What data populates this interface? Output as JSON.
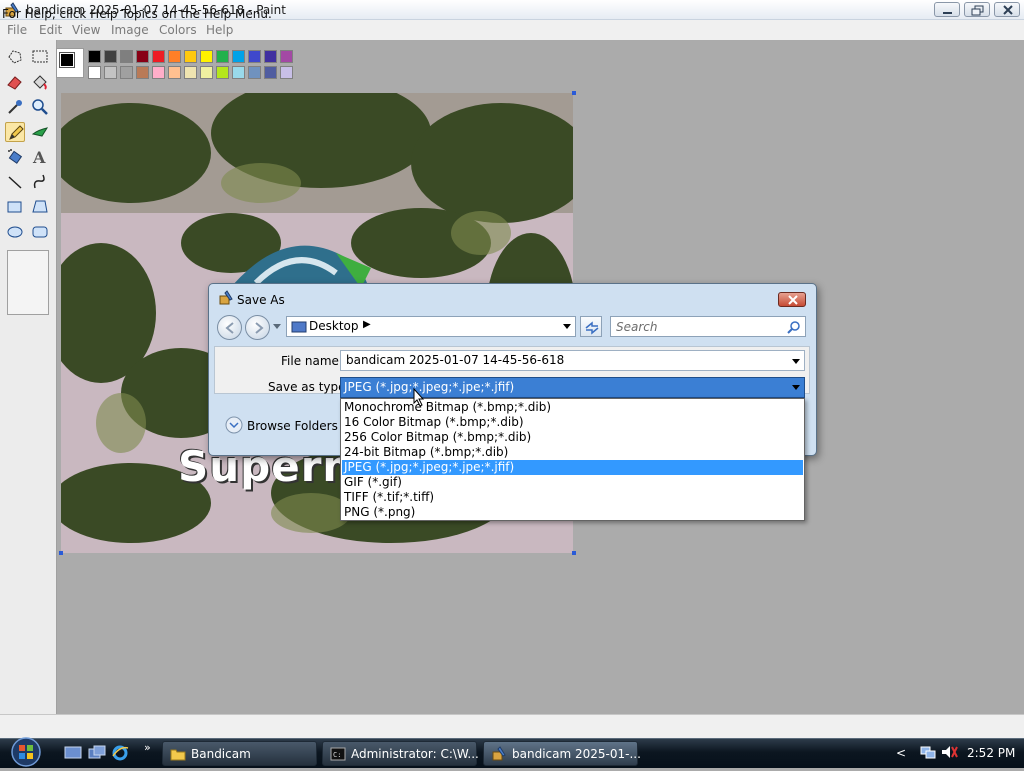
{
  "window": {
    "title": "bandicam 2025-01-07 14-45-56-618 - Paint"
  },
  "menu": {
    "items": [
      "File",
      "Edit",
      "View",
      "Image",
      "Colors",
      "Help"
    ]
  },
  "toolbox": {
    "tools": [
      "free-select",
      "select",
      "eraser",
      "fill",
      "color-picker",
      "magnifier",
      "pencil",
      "brush",
      "airbrush",
      "text",
      "line",
      "curve",
      "rectangle",
      "polygon",
      "ellipse",
      "rounded-rectangle"
    ],
    "active_tool": "pencil"
  },
  "palette": {
    "foreground": "#000000",
    "background": "#ffffff",
    "row1": [
      "#000000",
      "#404040",
      "#7f7f7f",
      "#880015",
      "#ed1c24",
      "#ff7f27",
      "#ffc90e",
      "#fff200",
      "#22b14c",
      "#00a2e8",
      "#3f48cc",
      "#4030a0",
      "#a349a4"
    ],
    "row2": [
      "#ffffff",
      "#c3c3c3",
      "#a0a0a0",
      "#b97a57",
      "#ffaec9",
      "#ffc090",
      "#efe4b0",
      "#eff0a0",
      "#b5e61d",
      "#99d9ea",
      "#7092be",
      "#505da0",
      "#c8bfe7"
    ]
  },
  "canvas": {
    "overlay_text": "Superm"
  },
  "status": {
    "text": "For Help, click Help Topics on the Help Menu."
  },
  "save_dialog": {
    "title": "Save As",
    "location": "Desktop",
    "search_placeholder": "Search",
    "file_name_label": "File name:",
    "file_name_value": "bandicam 2025-01-07 14-45-56-618",
    "save_type_label": "Save as type:",
    "save_type_value": "JPEG (*.jpg;*.jpeg;*.jpe;*.jfif)",
    "browse_folders_label": "Browse Folders",
    "type_options": [
      "Monochrome Bitmap (*.bmp;*.dib)",
      "16 Color Bitmap (*.bmp;*.dib)",
      "256 Color Bitmap (*.bmp;*.dib)",
      "24-bit Bitmap (*.bmp;*.dib)",
      "JPEG (*.jpg;*.jpeg;*.jpe;*.jfif)",
      "GIF (*.gif)",
      "TIFF (*.tif;*.tiff)",
      "PNG (*.png)"
    ],
    "selected_option_index": 4
  },
  "taskbar": {
    "buttons": [
      {
        "label": "Bandicam",
        "icon": "folder-icon"
      },
      {
        "label": "Administrator: C:\\W...",
        "icon": "cmd-icon"
      },
      {
        "label": "bandicam 2025-01-...",
        "icon": "paint-icon"
      }
    ],
    "time": "2:52 PM"
  }
}
